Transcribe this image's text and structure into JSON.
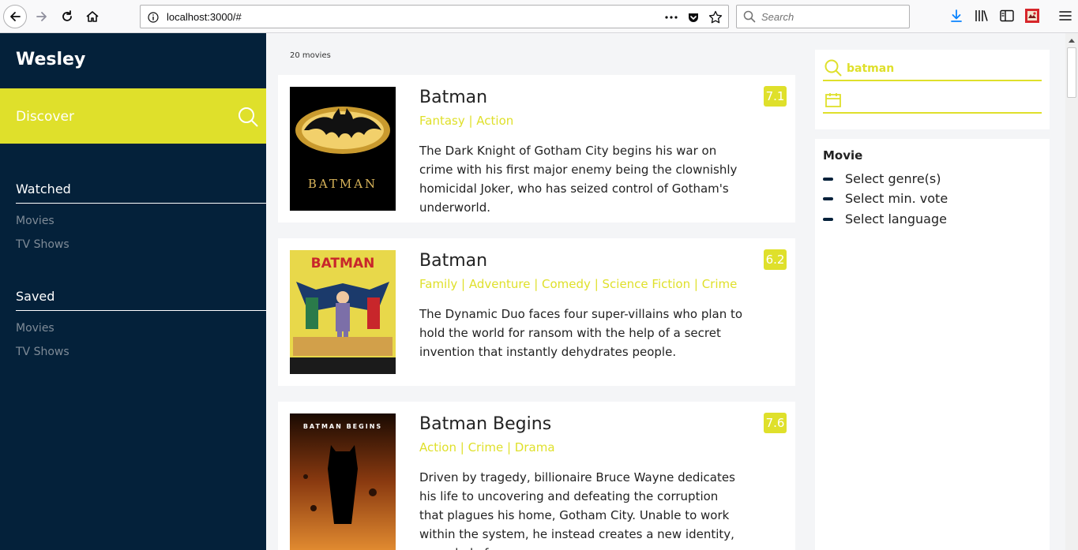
{
  "browser": {
    "url": "localhost:3000/#",
    "search_placeholder": "Search",
    "icons": [
      "back-arrow-icon",
      "forward-arrow-icon",
      "reload-icon",
      "home-icon",
      "info-icon",
      "more-dots-icon",
      "pocket-icon",
      "bookmark-star-icon",
      "search-icon",
      "download-icon",
      "library-icon",
      "sidebar-icon",
      "extension-icon",
      "menu-icon"
    ]
  },
  "sidebar": {
    "brand": "Wesley",
    "discover_label": "Discover",
    "sections": [
      {
        "title": "Watched",
        "links": [
          "Movies",
          "TV Shows"
        ]
      },
      {
        "title": "Saved",
        "links": [
          "Movies",
          "TV Shows"
        ]
      }
    ]
  },
  "main": {
    "count_label": "20 movies",
    "movies": [
      {
        "title": "Batman",
        "genres": "Fantasy | Action",
        "vote": "7.1",
        "overview": "The Dark Knight of Gotham City begins his war on crime with his first major enemy being the clownishly homicidal Joker, who has seized control of Gotham's underworld.",
        "poster_text": "BATMAN"
      },
      {
        "title": "Batman",
        "genres": "Family | Adventure | Comedy | Science Fiction | Crime",
        "vote": "6.2",
        "overview": "The Dynamic Duo faces four super-villains who plan to hold the world for ransom with the help of a secret invention that instantly dehydrates people.",
        "poster_text": "BATMAN"
      },
      {
        "title": "Batman Begins",
        "genres": "Action | Crime | Drama",
        "vote": "7.6",
        "overview": "Driven by tragedy, billionaire Bruce Wayne dedicates his life to uncovering and defeating the corruption that plagues his home, Gotham City. Unable to work within the system, he instead creates a new identity, a symbol of",
        "poster_text": "BATMAN BEGINS"
      }
    ]
  },
  "search_panel": {
    "query": "batman",
    "date_value": ""
  },
  "filters": {
    "title": "Movie",
    "items": [
      "Select genre(s)",
      "Select min. vote",
      "Select language"
    ]
  },
  "colors": {
    "accent": "#dfe02b",
    "sidebar_bg": "#04213a",
    "page_bg": "#f4f5f7"
  }
}
